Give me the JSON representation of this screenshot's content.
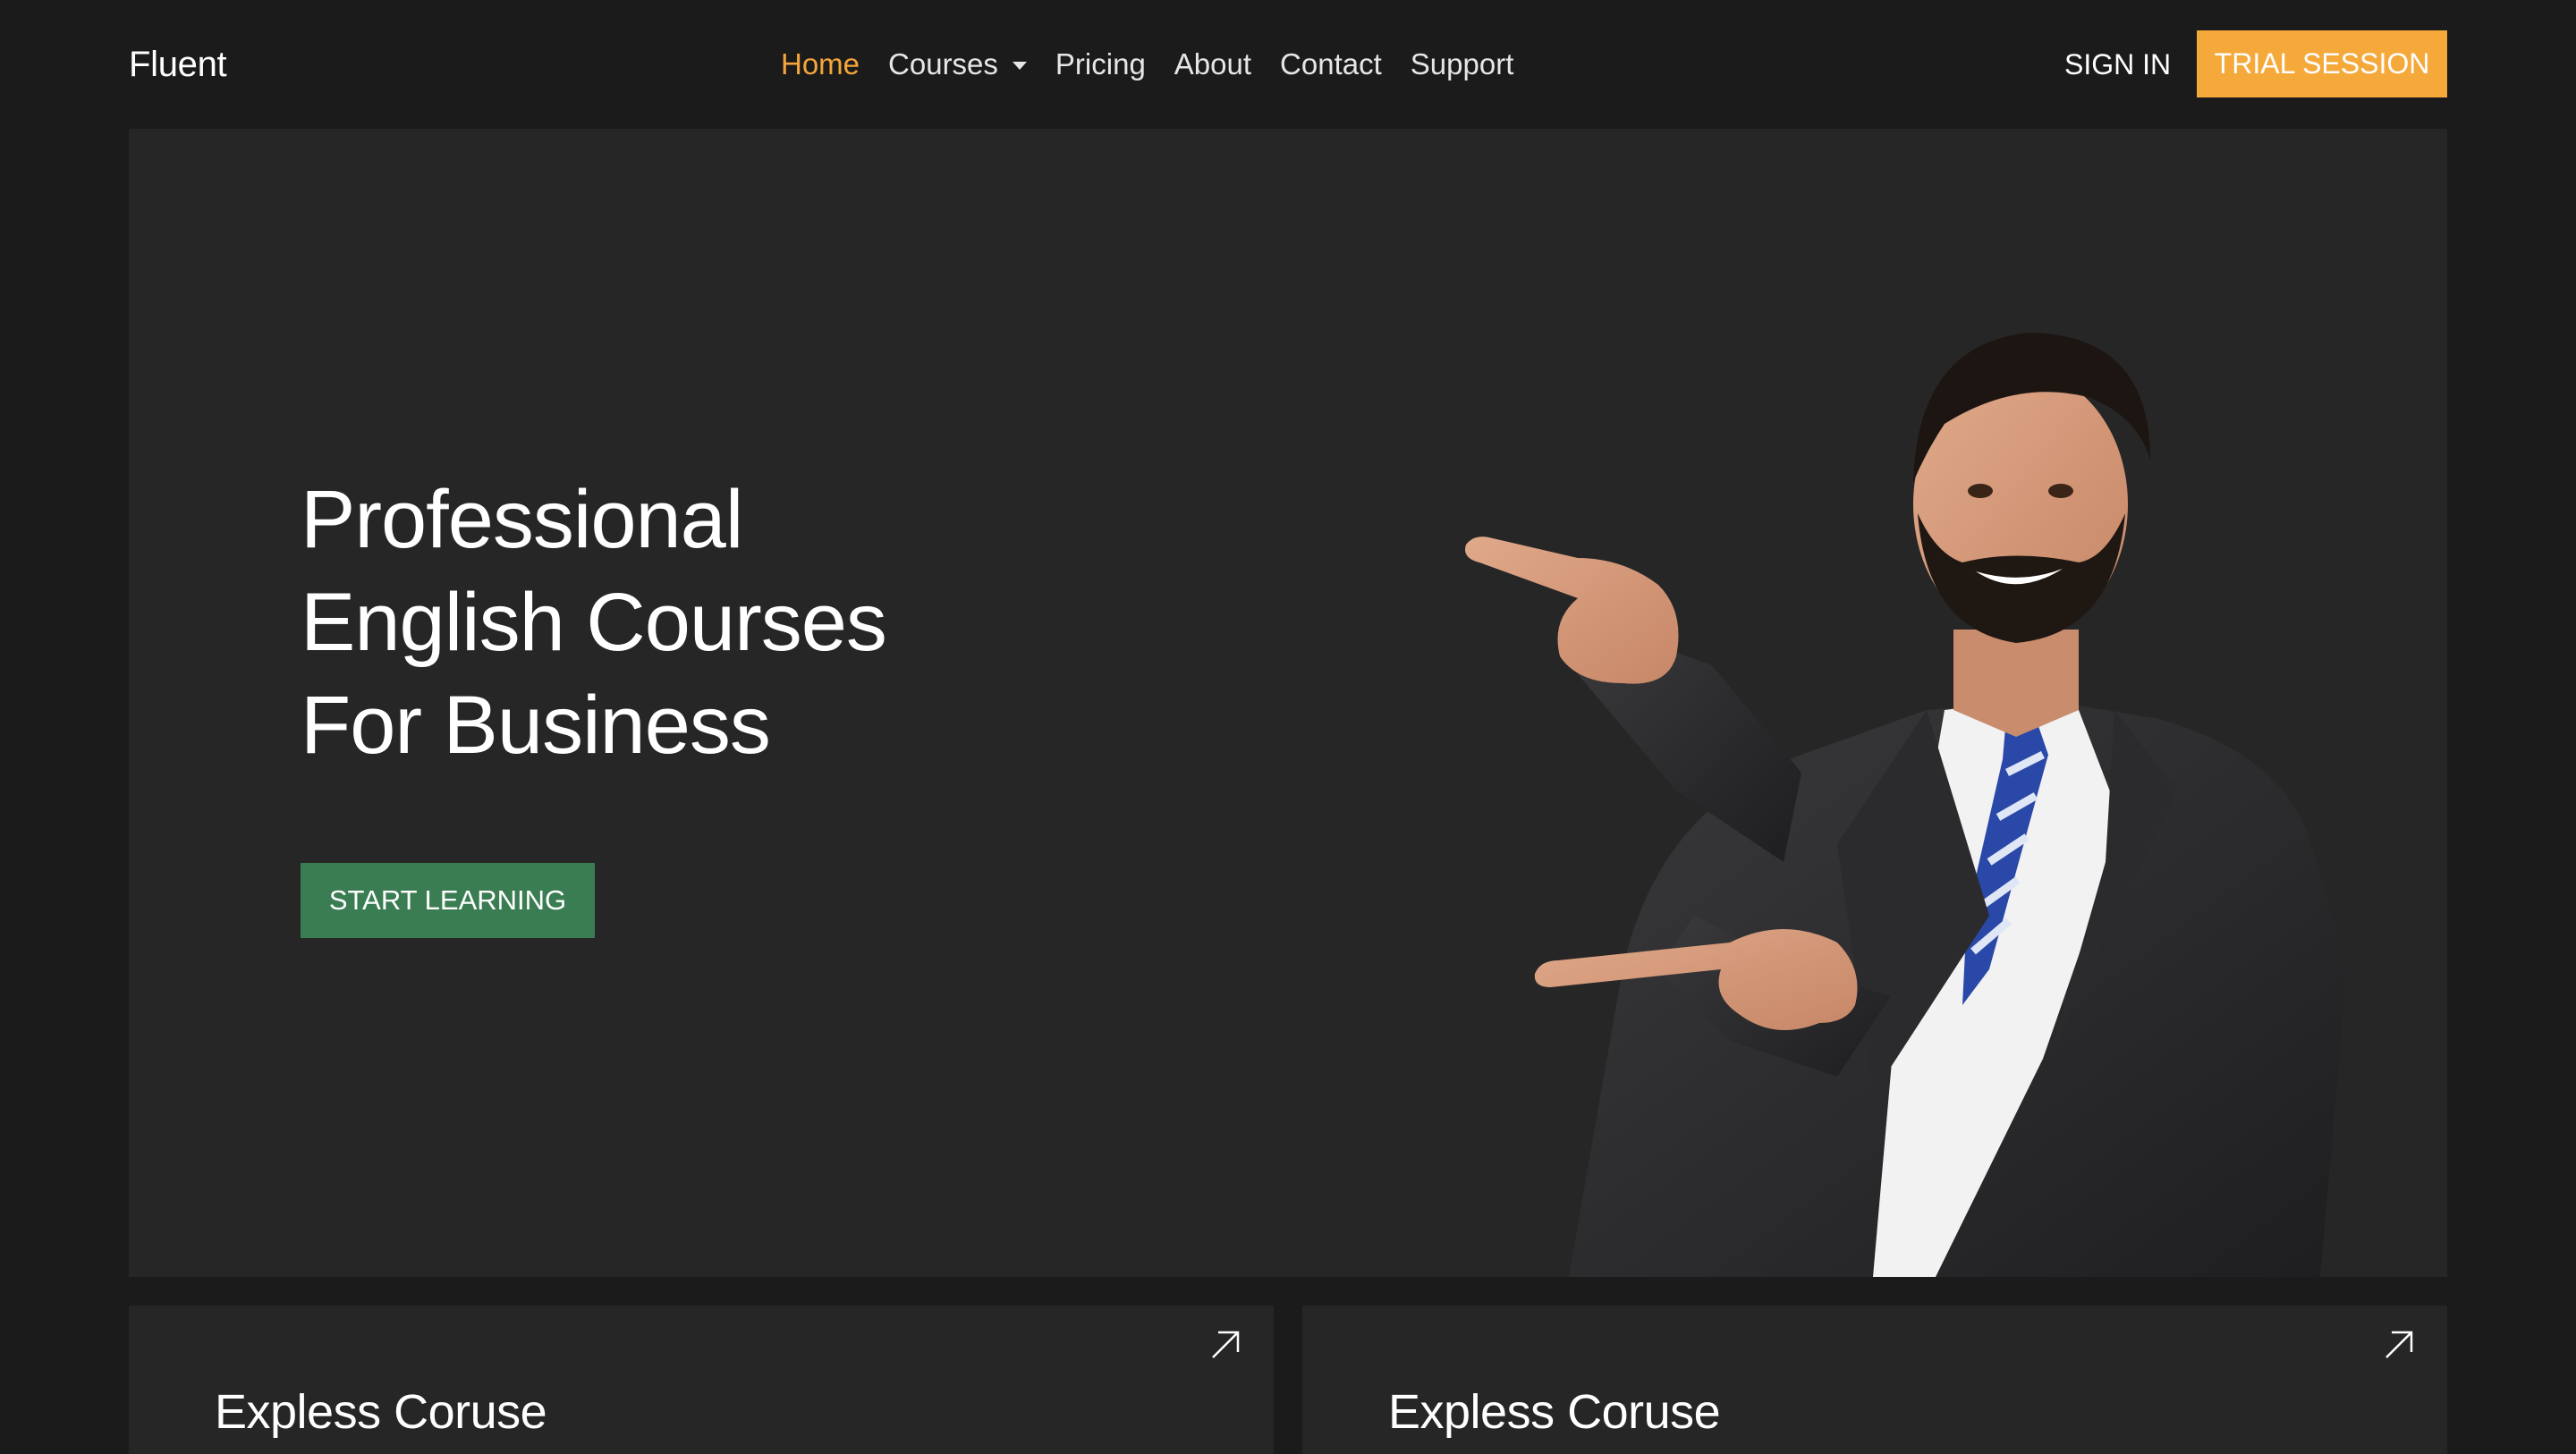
{
  "brand": "Fluent",
  "nav": {
    "items": [
      {
        "label": "Home",
        "active": true
      },
      {
        "label": "Courses",
        "dropdown": true
      },
      {
        "label": "Pricing"
      },
      {
        "label": "About"
      },
      {
        "label": "Contact"
      },
      {
        "label": "Support"
      }
    ],
    "sign_in": "SIGN IN",
    "trial_label": "TRIAL SESSION"
  },
  "hero": {
    "title_lines": [
      "Professional",
      "English Courses",
      "For Business"
    ],
    "cta_label": "START LEARNING",
    "image": "businessman-pointing-photo"
  },
  "cards": [
    {
      "title": "Expless Coruse",
      "icon": "arrow-up-right-icon"
    },
    {
      "title": "Expless Coruse",
      "icon": "arrow-up-right-icon"
    }
  ],
  "colors": {
    "background": "#1b1b1b",
    "panel": "#262626",
    "accent": "#f5a93a",
    "cta": "#3a7d52",
    "nav_active": "#f4a63a"
  }
}
